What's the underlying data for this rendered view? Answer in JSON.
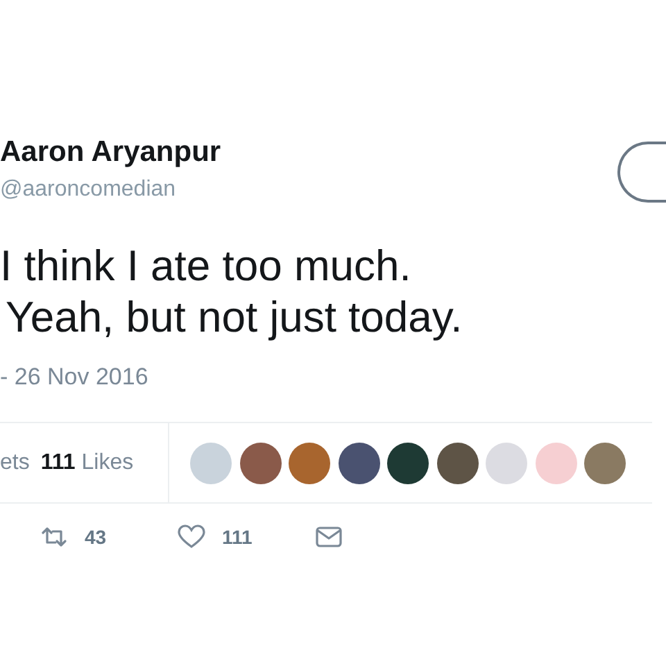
{
  "author": {
    "name": "Aaron Aryanpur",
    "handle": "@aaroncomedian"
  },
  "follow_button": {
    "kind": "outline"
  },
  "tweet_lines": [
    "I think I ate too much.",
    "Yeah, but not just today."
  ],
  "timestamp": "- 26 Nov 2016",
  "stats": {
    "retweets_label": "ets",
    "likes_count": "111",
    "likes_label": "Likes"
  },
  "liker_avatars": [
    {
      "color": "#c9d3dc"
    },
    {
      "color": "#8a5a4a"
    },
    {
      "color": "#a8652e"
    },
    {
      "color": "#4a5270"
    },
    {
      "color": "#1e3a34"
    },
    {
      "color": "#5e5446"
    },
    {
      "color": "#dcdce2"
    },
    {
      "color": "#f6cfd2"
    },
    {
      "color": "#8a7a62"
    }
  ],
  "actions": [
    {
      "kind": "retweet",
      "count": "43"
    },
    {
      "kind": "like",
      "count": "111"
    },
    {
      "kind": "message"
    }
  ]
}
